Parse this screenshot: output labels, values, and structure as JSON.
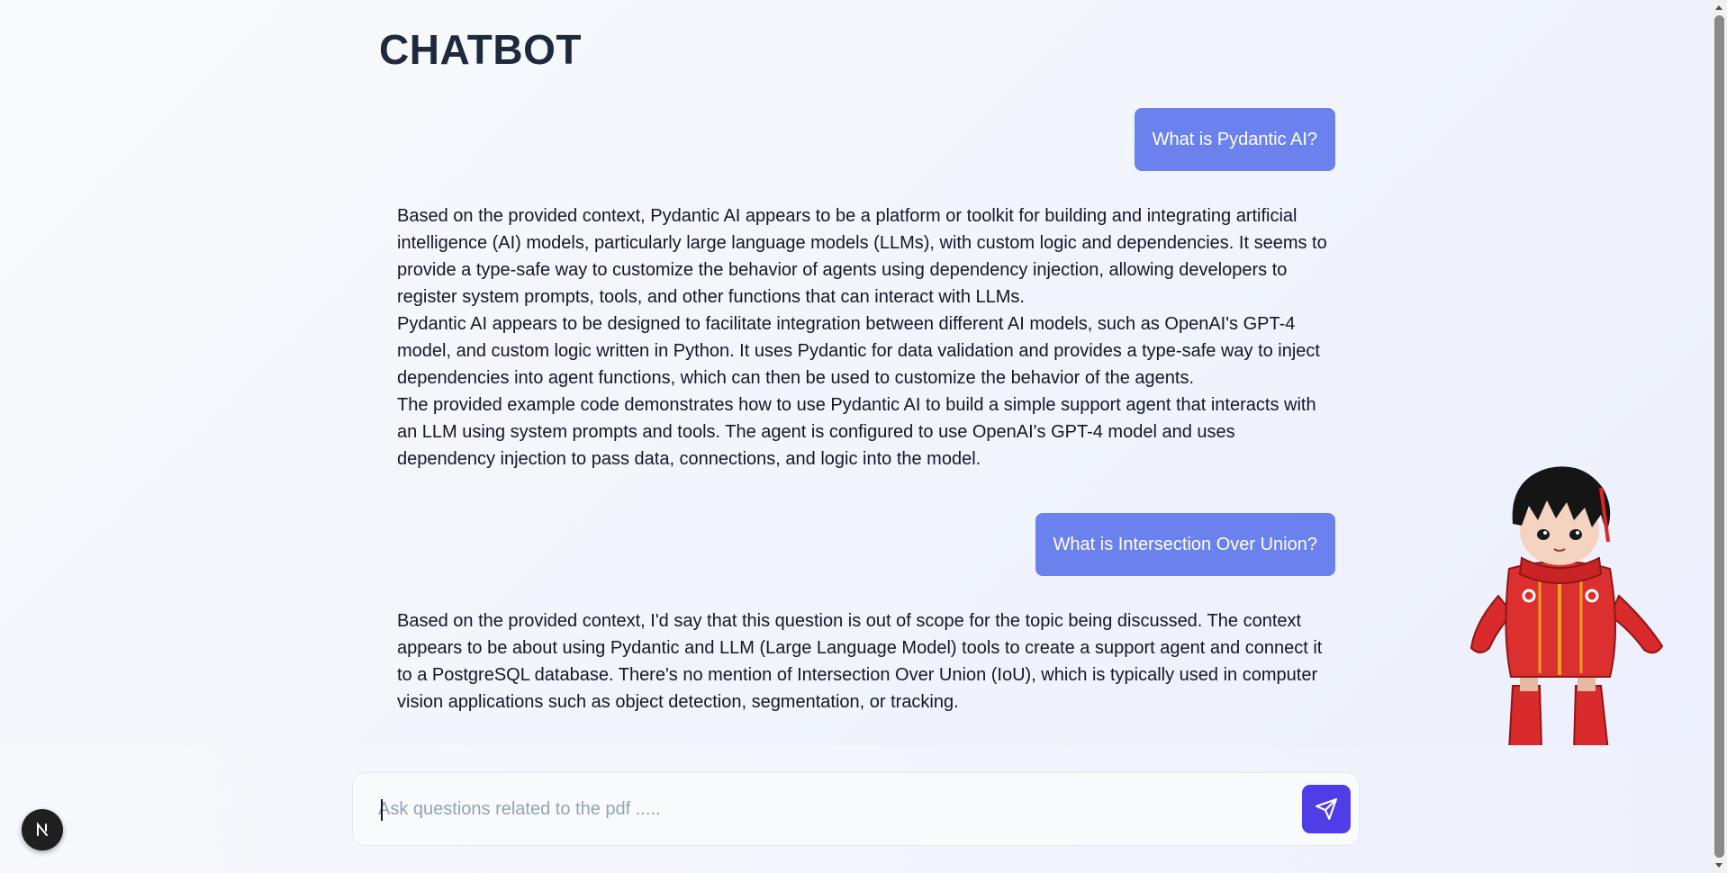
{
  "header": {
    "title": "CHATBOT"
  },
  "conversation": [
    {
      "role": "user",
      "text": "What is Pydantic AI?"
    },
    {
      "role": "assistant",
      "paragraphs": [
        "Based on the provided context, Pydantic AI appears to be a platform or toolkit for building and integrating artificial intelligence (AI) models, particularly large language models (LLMs), with custom logic and dependencies. It seems to provide a type-safe way to customize the behavior of agents using dependency injection, allowing developers to register system prompts, tools, and other functions that can interact with LLMs.",
        "Pydantic AI appears to be designed to facilitate integration between different AI models, such as OpenAI's GPT-4 model, and custom logic written in Python. It uses Pydantic for data validation and provides a type-safe way to inject dependencies into agent functions, which can then be used to customize the behavior of the agents.",
        "The provided example code demonstrates how to use Pydantic AI to build a simple support agent that interacts with an LLM using system prompts and tools. The agent is configured to use OpenAI's GPT-4 model and uses dependency injection to pass data, connections, and logic into the model."
      ]
    },
    {
      "role": "user",
      "text": "What is Intersection Over Union?"
    },
    {
      "role": "assistant",
      "paragraphs": [
        "Based on the provided context, I'd say that this question is out of scope for the topic being discussed. The context appears to be about using Pydantic and LLM (Large Language Model) tools to create a support agent and connect it to a PostgreSQL database. There's no mention of Intersection Over Union (IoU), which is typically used in computer vision applications such as object detection, segmentation, or tracking."
      ]
    }
  ],
  "composer": {
    "placeholder": "Ask questions related to the pdf .....",
    "value": "",
    "send_icon": "send-icon"
  },
  "dev_badge": {
    "letter": "N"
  },
  "mascot": {
    "icon": "chibi-character-mascot"
  },
  "colors": {
    "user_bubble": "#6b82ee",
    "send_button": "#4f3de8",
    "title": "#1e293b",
    "text": "#111827"
  }
}
